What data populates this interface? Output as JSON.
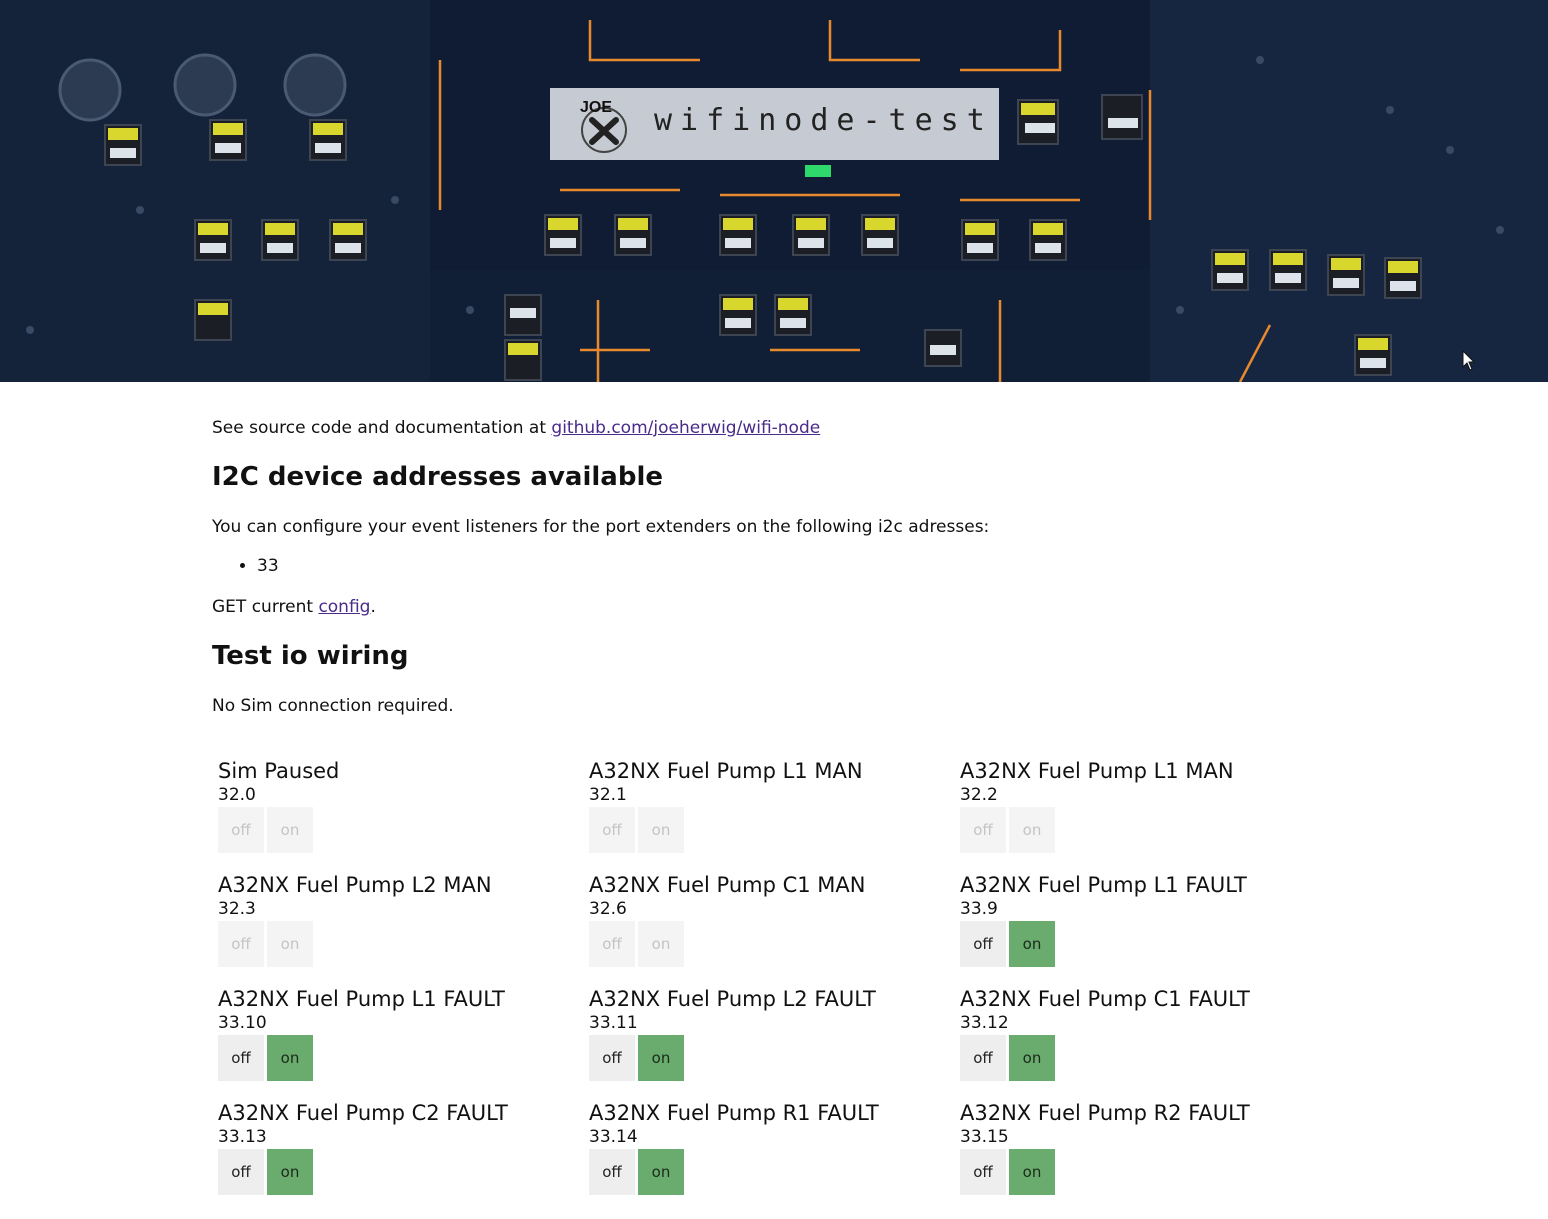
{
  "header": {
    "logo_text": "JOE",
    "site_title": "wifinode-test"
  },
  "intro": {
    "text": "See source code and documentation at ",
    "link_text": "github.com/joeherwig/wifi-node"
  },
  "i2c": {
    "heading": "I2C device addresses available",
    "description": "You can configure your event listeners for the port extenders on the following i2c adresses:",
    "addresses": [
      "33"
    ]
  },
  "config": {
    "prefix": "GET current ",
    "link_text": "config",
    "suffix": "."
  },
  "test": {
    "heading": "Test io wiring",
    "note": "No Sim connection required.",
    "labels": {
      "off": "off",
      "on": "on"
    },
    "colors": {
      "on_active": "#6aab6e",
      "inactive_bg": "#f4f4f4"
    },
    "items": [
      {
        "name": "Sim Paused",
        "address": "32.0",
        "active": false
      },
      {
        "name": "A32NX Fuel Pump L1 MAN",
        "address": "32.1",
        "active": false
      },
      {
        "name": "A32NX Fuel Pump L1 MAN",
        "address": "32.2",
        "active": false
      },
      {
        "name": "A32NX Fuel Pump L2 MAN",
        "address": "32.3",
        "active": false
      },
      {
        "name": "A32NX Fuel Pump C1 MAN",
        "address": "32.6",
        "active": false
      },
      {
        "name": "A32NX Fuel Pump L1 FAULT",
        "address": "33.9",
        "active": true
      },
      {
        "name": "A32NX Fuel Pump L1 FAULT",
        "address": "33.10",
        "active": true
      },
      {
        "name": "A32NX Fuel Pump L2 FAULT",
        "address": "33.11",
        "active": true
      },
      {
        "name": "A32NX Fuel Pump C1 FAULT",
        "address": "33.12",
        "active": true
      },
      {
        "name": "A32NX Fuel Pump C2 FAULT",
        "address": "33.13",
        "active": true
      },
      {
        "name": "A32NX Fuel Pump R1 FAULT",
        "address": "33.14",
        "active": true
      },
      {
        "name": "A32NX Fuel Pump R2 FAULT",
        "address": "33.15",
        "active": true
      }
    ]
  }
}
